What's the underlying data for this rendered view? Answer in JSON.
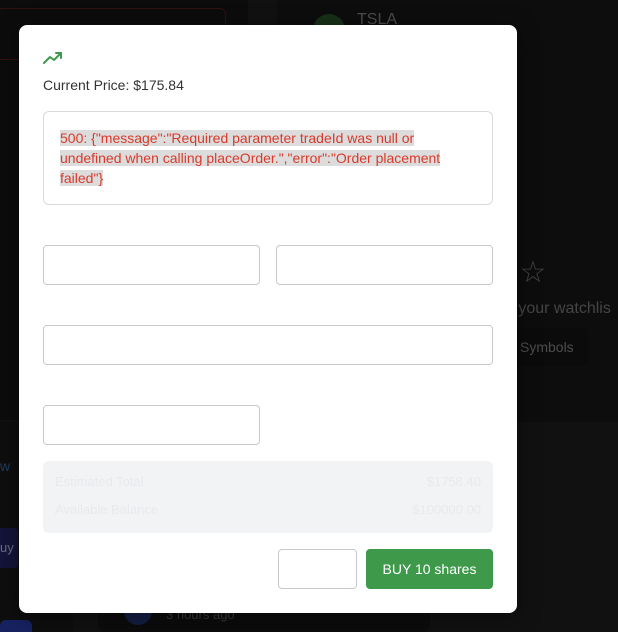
{
  "background": {
    "ticker": "TSLA",
    "watchlist_text": "n your watchlis",
    "symbols_button": "Symbols",
    "left_link_text": "w",
    "buy_chip_text": "uy",
    "time_ago": "3 hours ago"
  },
  "modal": {
    "trend_icon": "trending-up-icon",
    "current_price": "Current Price: $175.84",
    "error_message": "500: {\"message\":\"Required parameter tradeId was null or undefined when calling placeOrder.\",\"error\":\"Order placement failed\"}",
    "fields": [
      {
        "value": "",
        "placeholder": ""
      },
      {
        "value": "",
        "placeholder": ""
      },
      {
        "value": "",
        "placeholder": ""
      },
      {
        "value": "",
        "placeholder": ""
      }
    ],
    "summary": {
      "estimated_total_label": "Estimated Total",
      "estimated_total_value": "$1758.40",
      "available_balance_label": "Available Balance",
      "available_balance_value": "$100000.00"
    },
    "secondary_button": "",
    "buy_button": "BUY 10 shares",
    "colors": {
      "accent_green": "#3e9a4a",
      "error_red": "#d93a2b"
    }
  }
}
